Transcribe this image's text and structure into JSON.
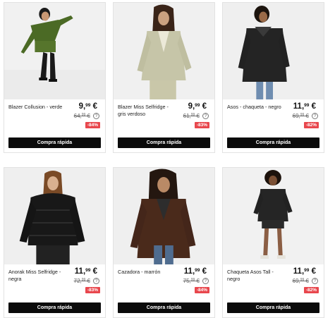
{
  "products": [
    {
      "name": "Blazer Collusion - verde",
      "price_main": "9,",
      "price_cents": "99",
      "price_cur": "€",
      "old_main": "64,",
      "old_cents": "99",
      "old_cur": "€",
      "discount": "-84%",
      "button": "Compra rápida"
    },
    {
      "name": "Blazer Miss Selfridge - gris verdoso",
      "price_main": "9,",
      "price_cents": "99",
      "price_cur": "€",
      "old_main": "61,",
      "old_cents": "99",
      "old_cur": "€",
      "discount": "-83%",
      "button": "Compra rápida"
    },
    {
      "name": "Asos - chaqueta - negro",
      "price_main": "11,",
      "price_cents": "99",
      "price_cur": "€",
      "old_main": "69,",
      "old_cents": "99",
      "old_cur": "€",
      "discount": "-82%",
      "button": "Compra rápida"
    },
    {
      "name": "Anorak Miss Selfridge - negra",
      "price_main": "11,",
      "price_cents": "99",
      "price_cur": "€",
      "old_main": "72,",
      "old_cents": "99",
      "old_cur": "€",
      "discount": "-83%",
      "button": "Compra rápida"
    },
    {
      "name": "Cazadora - marrón",
      "price_main": "11,",
      "price_cents": "99",
      "price_cur": "€",
      "old_main": "75,",
      "old_cents": "99",
      "old_cur": "€",
      "discount": "-84%",
      "button": "Compra rápida"
    },
    {
      "name": "Chaqueta Asos Tall - negro",
      "price_main": "11,",
      "price_cents": "99",
      "price_cur": "€",
      "old_main": "69,",
      "old_cents": "99",
      "old_cur": "€",
      "discount": "-82%",
      "button": "Compra rápida"
    }
  ],
  "help_icon": "?",
  "colors": {
    "discount_badge": "#e8474d",
    "button_bg": "#0b0b0b"
  }
}
